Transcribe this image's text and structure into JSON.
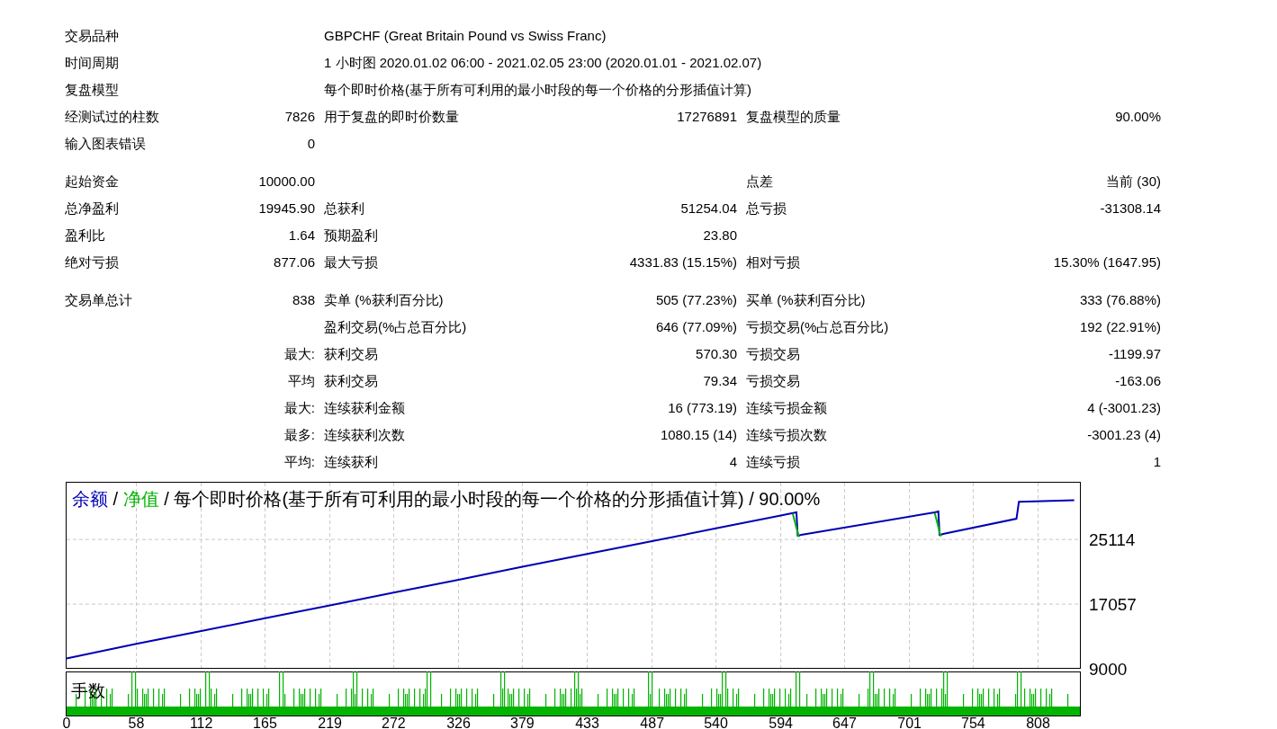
{
  "report": {
    "groups": [
      {
        "rows": [
          {
            "label_1": "交易品种",
            "detail": "GBPCHF (Great Britain Pound vs Swiss Franc)"
          },
          {
            "label_1": "时间周期",
            "detail": "1 小时图 2020.01.02 06:00 - 2021.02.05 23:00 (2020.01.01 - 2021.02.07)"
          },
          {
            "label_1": "复盘模型",
            "detail": "每个即时价格(基于所有可利用的最小时段的每一个价格的分形插值计算)"
          },
          {
            "label_1": "经测试过的柱数",
            "value_1": "7826",
            "label_2": "用于复盘的即时价数量",
            "value_2": "17276891",
            "label_3": "复盘模型的质量",
            "value_3": "90.00%"
          },
          {
            "label_1": "输入图表错误",
            "value_1": "0"
          }
        ]
      },
      {
        "rows": [
          {
            "label_1": "起始资金",
            "value_1": "10000.00",
            "label_3": "点差",
            "value_3": "当前 (30)"
          },
          {
            "label_1": "总净盈利",
            "value_1": "19945.90",
            "label_2": "总获利",
            "value_2": "51254.04",
            "label_3": "总亏损",
            "value_3": "-31308.14"
          },
          {
            "label_1": "盈利比",
            "value_1": "1.64",
            "label_2": "预期盈利",
            "value_2": "23.80"
          },
          {
            "label_1": "绝对亏损",
            "value_1": "877.06",
            "label_2": "最大亏损",
            "value_2": "4331.83 (15.15%)",
            "label_3": "相对亏损",
            "value_3": "15.30% (1647.95)"
          }
        ]
      },
      {
        "rows": [
          {
            "label_1": "交易单总计",
            "value_1": "838",
            "label_2": "卖单 (%获利百分比)",
            "value_2": "505 (77.23%)",
            "label_3": "买单 (%获利百分比)",
            "value_3": "333 (76.88%)"
          },
          {
            "label_2": "盈利交易(%占总百分比)",
            "value_2": "646 (77.09%)",
            "label_3": "亏损交易(%占总百分比)",
            "value_3": "192 (22.91%)"
          },
          {
            "value_1": "最大:",
            "label_2": "获利交易",
            "value_2": "570.30",
            "label_3": "亏损交易",
            "value_3": "-1199.97"
          },
          {
            "value_1": "平均",
            "label_2": "获利交易",
            "value_2": "79.34",
            "label_3": "亏损交易",
            "value_3": "-163.06"
          },
          {
            "value_1": "最大:",
            "label_2": "连续获利金额",
            "value_2": "16 (773.19)",
            "label_3": "连续亏损金额",
            "value_3": "4 (-3001.23)"
          },
          {
            "value_1": "最多:",
            "label_2": "连续获利次数",
            "value_2": "1080.15 (14)",
            "label_3": "连续亏损次数",
            "value_3": "-3001.23 (4)"
          },
          {
            "value_1": "平均:",
            "label_2": "连续获利",
            "value_2": "4",
            "label_3": "连续亏损",
            "value_3": "1"
          }
        ]
      }
    ]
  },
  "chart": {
    "legend_separator": "/",
    "lots_panel": {
      "label": "手数"
    },
    "chart_data": {
      "type": "line",
      "title": "每个即时价格(基于所有可利用的最小时段的每一个价格的分形插值计算) / 90.00%",
      "x": [
        0,
        58,
        112,
        165,
        219,
        272,
        326,
        379,
        433,
        487,
        540,
        594,
        604,
        607,
        608,
        609,
        611,
        722,
        725,
        726,
        727,
        729,
        790,
        792,
        838
      ],
      "series": [
        {
          "name": "余额",
          "color": "#0000b4",
          "values": [
            10300,
            12100,
            13700,
            15300,
            16900,
            18500,
            20100,
            21700,
            23300,
            24900,
            26500,
            28100,
            28400,
            28500,
            25600,
            25600,
            25700,
            28500,
            28600,
            25700,
            25700,
            25800,
            27700,
            29800,
            30000
          ]
        },
        {
          "name": "净值",
          "color": "#00b400",
          "values": [
            null,
            null,
            null,
            null,
            null,
            null,
            null,
            null,
            null,
            null,
            null,
            null,
            28300,
            26560,
            25980,
            25400,
            null,
            28400,
            26660,
            26080,
            25500,
            null,
            null,
            null,
            null
          ]
        }
      ],
      "grid": true,
      "xlim": [
        0,
        842
      ],
      "ylim": [
        9000,
        32300
      ],
      "yticks": [
        9000,
        17057,
        25114
      ],
      "xticks": [
        0,
        58,
        112,
        165,
        219,
        272,
        326,
        379,
        433,
        487,
        540,
        594,
        647,
        701,
        754,
        808
      ]
    }
  }
}
